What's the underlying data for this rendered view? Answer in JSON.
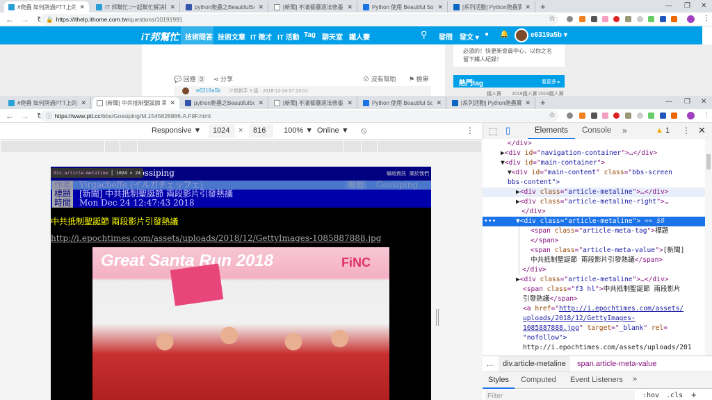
{
  "back_window": {
    "tabs": [
      {
        "title": "#爬蟲 如何誇過PTT上的你成年",
        "active": true,
        "color": "#2a9fd8"
      },
      {
        "title": "IT 邦幫忙::一起幫忙解決難題，拯",
        "color": "#2a9fd8"
      },
      {
        "title": "python爬蟲之BeautifulSoup - 简",
        "color": "#3355aa"
      },
      {
        "title": "[新聞] 不滿餐廳違法修墨 書園批餐廳",
        "color": "#888"
      },
      {
        "title": "Python 使用 Beautiful Soup 抓取",
        "color": "#1a73e8"
      },
      {
        "title": "[系列活動] Python爬蟲實戰",
        "color": "#0a66c2"
      }
    ],
    "url_host": "https://ithelp.ithome.com.tw",
    "url_path": "/questions/10191991",
    "site": {
      "logo": "iT邦幫忙",
      "nav": [
        "技術問答",
        "技術文章",
        "IT 徵才",
        "IT 活動",
        "Tag",
        "聊天室",
        "鐵人賽"
      ],
      "ask": "發問",
      "post": "發文 ▾",
      "user": "e6319a5b ▾",
      "accent": "#00a0e9"
    },
    "reply_label": "回應",
    "reply_count": "3",
    "share_label": "分享",
    "no_help": "沒有幫助",
    "report": "檢舉",
    "sidebar_text": "必須的！快更新會員中心，以你之名留下鐵人紀錄！",
    "hot_tag_title": "熱門tag",
    "see_more": "看更多 ▸",
    "tags": [
      "鐵人賽",
      "2019鐵人賽",
      "2019鐵人賽"
    ],
    "comment_user": "e6319a5b",
    "comment_meta": "iT邦新手 5 級 · 2018-12-24 07:23:01"
  },
  "front_window": {
    "tabs": [
      {
        "title": "#爬蟲 如何誇過PTT上的你成年",
        "color": "#2a9fd8"
      },
      {
        "title": "[新聞] 中共抵制聖誕節 兩段影片引",
        "active": true,
        "color": "#888"
      },
      {
        "title": "python爬蟲之BeautifulSoup - 简",
        "color": "#3355aa"
      },
      {
        "title": "[新聞] 不滿餐廳違法修墨 書園批餐",
        "color": "#888"
      },
      {
        "title": "Python 使用 Beautiful Soup 抓取",
        "color": "#1a73e8"
      },
      {
        "title": "[系列活動] Python爬蟲實戰",
        "color": "#0a66c2"
      }
    ],
    "url_host": "https://www.ptt.cc",
    "url_path": "/bbs/Gossiping/M.1545626886.A.F9F.html",
    "device_toolbar": {
      "device": "Responsive ▼",
      "width": "1024",
      "height": "816",
      "x": "×",
      "zoom": "100% ▼",
      "network": "Online ▼"
    },
    "ptt": {
      "board": "Gossiping",
      "links": [
        "聯絡資訊",
        "關於我們"
      ],
      "tooltip_sel": "div.article-metaline",
      "tooltip_size": "1024 × 24",
      "author_tag": "作者",
      "author": "Yirgacheffe (イルガチェッフェ)",
      "board_tag": "看板",
      "board_value": "Gossiping",
      "title_tag": "標題",
      "title": "[新聞] 中共抵制聖誕節 兩段影片引發熱議",
      "time_tag": "時間",
      "time": "Mon Dec 24 12:47:43 2018",
      "headline": "中共抵制聖誕節 兩段影片引發熱議",
      "link": "http://i.epochtimes.com/assets/uploads/2018/12/GettyImages-1085887888.jpg",
      "image_text": "Great Santa Run 2018",
      "image_brand": "FiNC"
    }
  },
  "devtools": {
    "tabs": [
      "Elements",
      "Console",
      "»"
    ],
    "warnings": "1",
    "tree": {
      "l1": "</div>",
      "nav_id": "navigation-container",
      "main_id": "main-container",
      "content_id": "main-content",
      "content_class": "bbs-screen",
      "content_class2": "bbs-content\">",
      "metaline": "article-metaline",
      "metaline_right": "article-metaline-right",
      "eq": "== $0",
      "tag_class": "article-meta-tag",
      "tag_text": "標題",
      "val_class": "article-meta-value",
      "val_text": "[新聞]",
      "val_text2": "中共抵制聖誕節 兩段影片引發熱議",
      "f3_class": "f3 hl",
      "f3_text": "中共抵制聖誕節 兩段影片",
      "f3_text2": "引發熱議",
      "href1": "http://i.epochtimes.com/assets/",
      "href2": "uploads/2018/12/GettyImages-",
      "href3": "1085887888.jpg",
      "target": "_blank",
      "rel": "\"nofollow\">",
      "last": "http://i.epochtimes.com/assets/uploads/201"
    },
    "breadcrumb": [
      "...",
      "div.article-metaline",
      "span.article-meta-value"
    ],
    "style_tabs": [
      "Styles",
      "Computed",
      "Event Listeners",
      "»"
    ],
    "filter_placeholder": "Filter",
    "hov": ":hov",
    ".cls": ".cls",
    "plus": "+"
  }
}
